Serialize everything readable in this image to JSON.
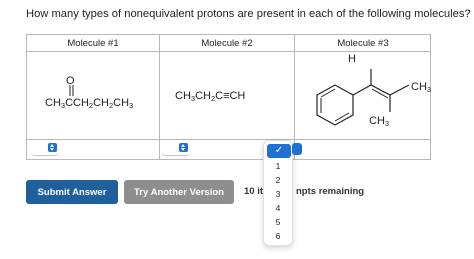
{
  "question": "How many types of nonequivalent protons are present in each of the following molecules?",
  "table": {
    "headers": [
      "Molecule #1",
      "Molecule #2",
      "Molecule #3"
    ],
    "molecule1": {
      "o_label": "O",
      "c1": "CH",
      "s1": "3",
      "c2": "CCH",
      "s2": "2",
      "c3": "CH",
      "s3": "2",
      "c4": "CH",
      "s4": "3"
    },
    "molecule2": {
      "c1": "CH",
      "s1": "3",
      "c2": "CH",
      "s2": "2",
      "c3": "C≡CH"
    },
    "molecule3": {
      "h_label": "H",
      "ch3_right": "CH",
      "ch3_right_sub": "3",
      "ch3_bottom": "CH",
      "ch3_bottom_sub": "3"
    }
  },
  "selects": [
    {
      "value": ""
    },
    {
      "value": ""
    },
    {
      "value": ""
    }
  ],
  "buttons": {
    "submit": "Submit Answer",
    "try_another": "Try Another Version"
  },
  "versions_text": "10 ite",
  "attempts_text": "npts remaining",
  "dropdown": {
    "selected_mark": "✓",
    "options": [
      "1",
      "2",
      "3",
      "4",
      "5",
      "6"
    ]
  },
  "colors": {
    "accent": "#1e6fd6",
    "submit_bg": "#1f5f9c",
    "try_bg": "#8e8e8e"
  }
}
